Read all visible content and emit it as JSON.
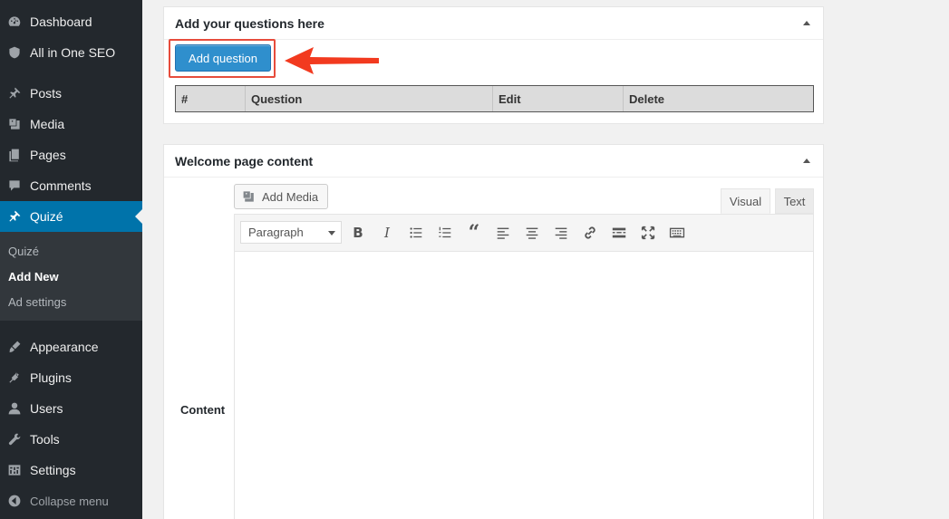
{
  "sidebar": {
    "items": [
      {
        "label": "Dashboard",
        "icon": "dashboard-icon"
      },
      {
        "label": "All in One SEO",
        "icon": "shield-icon"
      },
      {
        "label": "Posts",
        "icon": "pin-icon"
      },
      {
        "label": "Media",
        "icon": "media-icon"
      },
      {
        "label": "Pages",
        "icon": "pages-icon"
      },
      {
        "label": "Comments",
        "icon": "comment-icon"
      },
      {
        "label": "Quizé",
        "icon": "pin-icon"
      },
      {
        "label": "Appearance",
        "icon": "brush-icon"
      },
      {
        "label": "Plugins",
        "icon": "plug-icon"
      },
      {
        "label": "Users",
        "icon": "user-icon"
      },
      {
        "label": "Tools",
        "icon": "wrench-icon"
      },
      {
        "label": "Settings",
        "icon": "settings-icon"
      }
    ],
    "submenu": [
      "Quizé",
      "Add New",
      "Ad settings"
    ],
    "collapse_label": "Collapse menu",
    "active_color": "#0073aa"
  },
  "questions_panel": {
    "title": "Add your questions here",
    "add_button": "Add question",
    "table_headers": [
      "#",
      "Question",
      "Edit",
      "Delete"
    ]
  },
  "welcome_panel": {
    "title": "Welcome page content",
    "content_label": "Content",
    "add_media": "Add Media",
    "tab_visual": "Visual",
    "tab_text": "Text",
    "format_value": "Paragraph",
    "toolbar_icons": [
      "bold-icon",
      "italic-icon",
      "bullet-list-icon",
      "numbered-list-icon",
      "blockquote-icon",
      "align-left-icon",
      "align-center-icon",
      "align-right-icon",
      "link-icon",
      "read-more-icon",
      "fullscreen-icon",
      "keyboard-icon"
    ]
  },
  "colors": {
    "highlight": "#e74c3c",
    "button": "#2f8fcd"
  }
}
